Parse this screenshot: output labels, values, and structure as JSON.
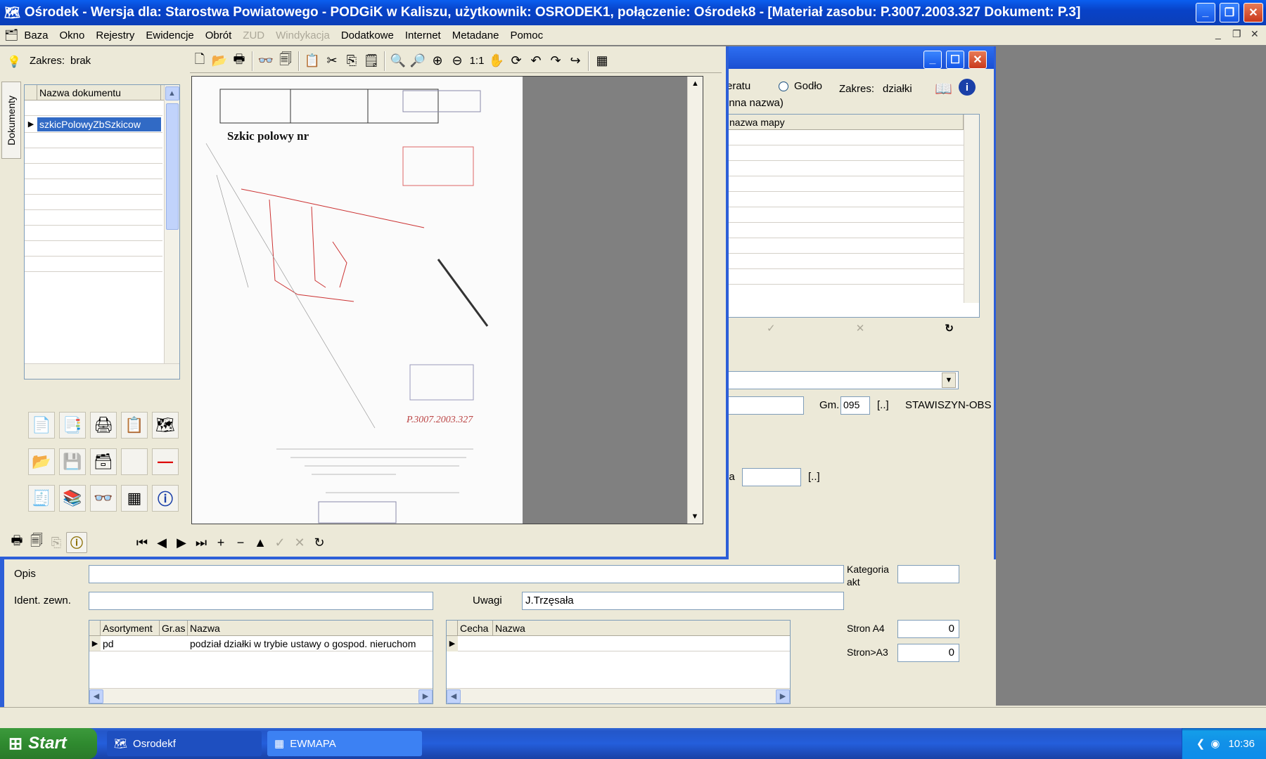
{
  "window": {
    "title": "Ośrodek - Wersja dla: Starostwa Powiatowego - PODGiK w Kaliszu, użytkownik: OSRODEK1, połączenie: Ośrodek8 - [Materiał zasobu: P.3007.2003.327   Dokument: P.3]"
  },
  "menu": [
    "Baza",
    "Okno",
    "Rejestry",
    "Ewidencje",
    "Obrót",
    "ZUD",
    "Windykacja",
    "Dodatkowe",
    "Internet",
    "Metadane",
    "Pomoc"
  ],
  "menu_disabled": [
    "ZUD",
    "Windykacja"
  ],
  "docs_panel": {
    "side_tab": "Dokumenty",
    "scope_label": "Zakres:",
    "scope_value": "brak",
    "grid_header": "Nazwa dokumentu",
    "selected_row": "szkicPolowyZbSzkicow"
  },
  "viewer": {
    "zoom_label": "1:1",
    "sketch_title": "Szkic polowy nr",
    "sketch_stamp": "P.3007.2003.327"
  },
  "map_window": {
    "radio_label_partial": "eratu",
    "radio_godlo": "Godło",
    "scope_label": "Zakres:",
    "scope_value": "działki",
    "sub_label": "inna nazwa)",
    "grid_header": "nazwa mapy",
    "gm_label": "Gm.",
    "gm_value": "095",
    "gm_btn": "[..]",
    "gm_name": "STAWISZYN-OBS",
    "field_label_partial": "ia",
    "field_btn": "[..]"
  },
  "main_form": {
    "opis_label": "Opis",
    "opis_value": "",
    "ident_label": "Ident. zewn.",
    "ident_value": "",
    "uwagi_label": "Uwagi",
    "uwagi_value": "J.Trzęsała",
    "kategoria_label_1": "Kategoria",
    "kategoria_label_2": "akt",
    "kategoria_value": "",
    "strona4_label": "Stron A4",
    "strona4_value": "0",
    "strona3_label": "Stron>A3",
    "strona3_value": "0",
    "asort_headers": [
      "Asortyment",
      "Gr.as",
      "Nazwa"
    ],
    "asort_rows": [
      {
        "asortyment": "pd",
        "gras": "",
        "nazwa": "podział działki w trybie ustawy o gospod. nieruchom"
      }
    ],
    "cecha_headers": [
      "Cecha",
      "Nazwa"
    ]
  },
  "taskbar": {
    "start": "Start",
    "items": [
      "Osrodekf",
      "EWMAPA"
    ],
    "clock": "10:36"
  }
}
